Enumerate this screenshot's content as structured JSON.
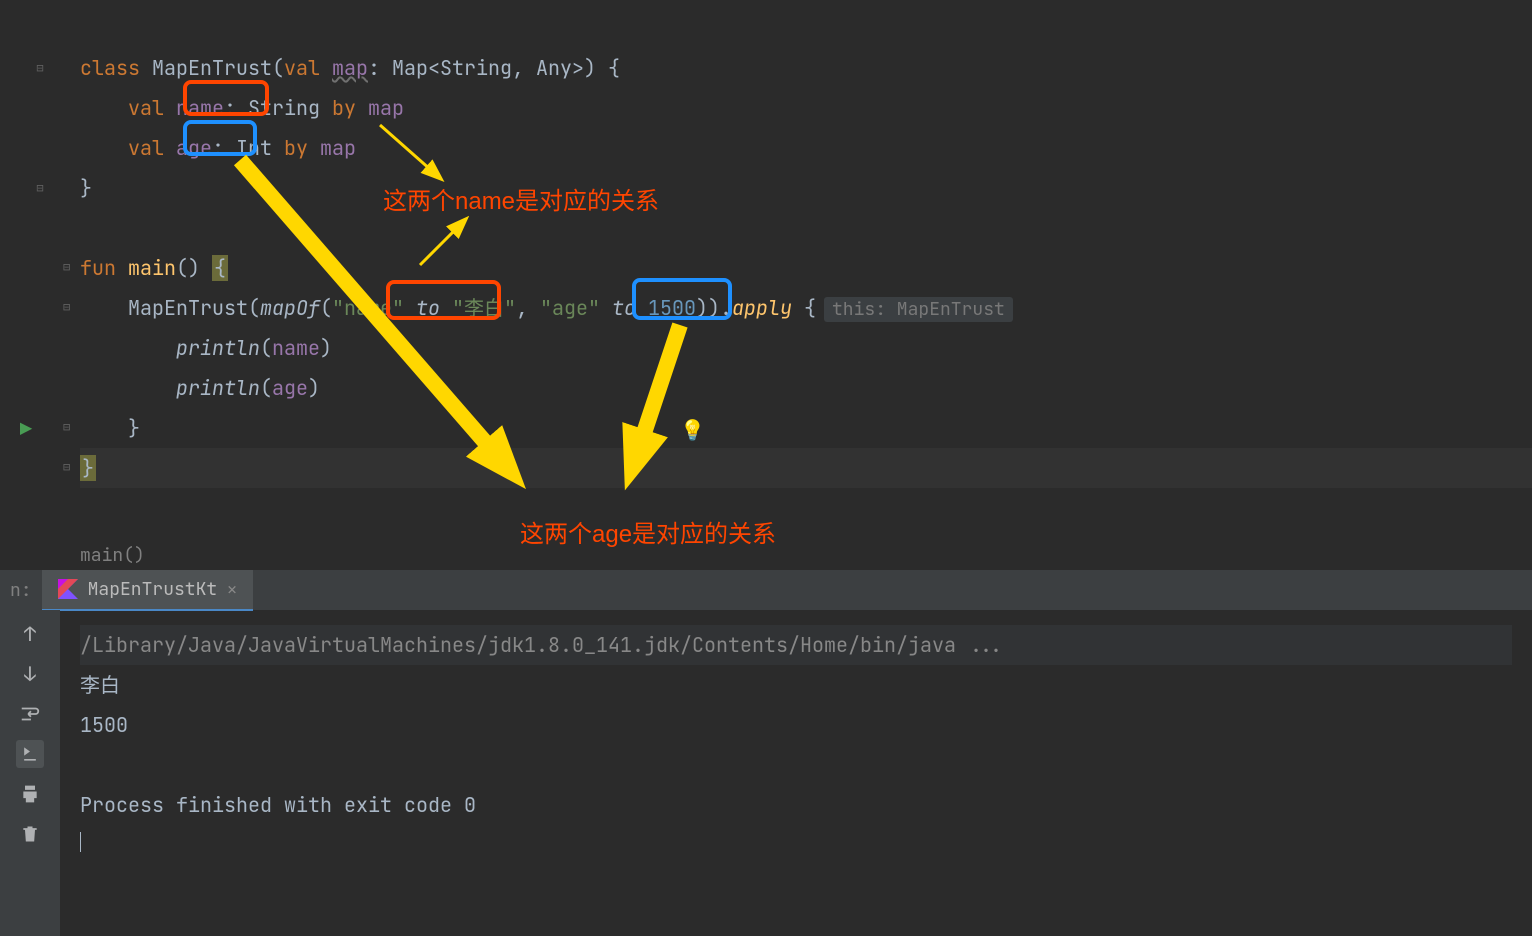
{
  "code": {
    "line1": {
      "class_kw": "class",
      "class_name": "MapEnTrust",
      "open_paren": "(",
      "val_kw": "val",
      "map_param": "map",
      "colon": ":",
      "map_type": "Map",
      "generic": "<String, Any>",
      "close": ") {"
    },
    "line2": {
      "val_kw": "val",
      "name_prop": "name",
      "colon": ":",
      "string_type": "String",
      "by_kw": "by",
      "map_ref": "map"
    },
    "line3": {
      "val_kw": "val",
      "age_prop": "age",
      "colon": ":",
      "int_type": "Int",
      "by_kw": "by",
      "map_ref": "map"
    },
    "line4": {
      "close": "}"
    },
    "line6": {
      "fun_kw": "fun",
      "main": "main",
      "parens": "()",
      "open": "{"
    },
    "line7": {
      "class_call": "MapEnTrust",
      "open": "(",
      "mapof": "mapOf",
      "open2": "(",
      "name_str": "\"name\"",
      "to1": "to",
      "libai": "\"李白\"",
      "comma": ",",
      "age_str": "\"age\"",
      "to2": "to",
      "num": "1500",
      "close": "))",
      "dot": ".",
      "apply": "apply",
      "brace": "{",
      "hint": "this: MapEnTrust"
    },
    "line8": {
      "println": "println",
      "open": "(",
      "name": "name",
      "close": ")"
    },
    "line9": {
      "println": "println",
      "open": "(",
      "age": "age",
      "close": ")"
    },
    "line10": {
      "close": "}"
    },
    "line11": {
      "close": "}"
    }
  },
  "annotations": {
    "name_rel": "这两个name是对应的关系",
    "age_rel": "这两个age是对应的关系"
  },
  "breadcrumb": "main()",
  "tabs": {
    "left_label": "n:",
    "tab_name": "MapEnTrustKt"
  },
  "console": {
    "cmd": "/Library/Java/JavaVirtualMachines/jdk1.8.0_141.jdk/Contents/Home/bin/java ...",
    "output1": "李白",
    "output2": "1500",
    "exit": "Process finished with exit code 0"
  }
}
